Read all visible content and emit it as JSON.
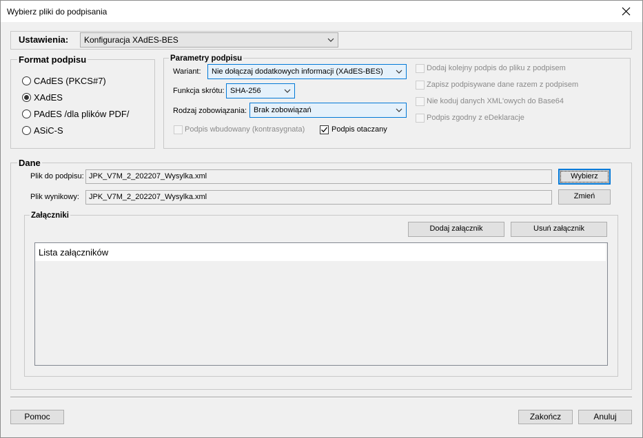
{
  "window": {
    "title": "Wybierz pliki do podpisania"
  },
  "settings": {
    "label": "Ustawienia:",
    "selected": "Konfiguracja XAdES-BES"
  },
  "format": {
    "title": "Format podpisu",
    "options": [
      {
        "label": "CAdES (PKCS#7)",
        "checked": false
      },
      {
        "label": "XAdES",
        "checked": true
      },
      {
        "label": "PAdES /dla plików PDF/",
        "checked": false
      },
      {
        "label": "ASiC-S",
        "checked": false
      }
    ]
  },
  "params": {
    "title": "Parametry podpisu",
    "variant_label": "Wariant:",
    "variant_value": "Nie dołączaj dodatkowych informacji (XAdES-BES)",
    "hash_label": "Funkcja skrótu:",
    "hash_value": "SHA-256",
    "commitment_label": "Rodzaj zobowiązania:",
    "commitment_value": "Brak zobowiązań",
    "embedded_label": "Podpis wbudowany (kontrasygnata)",
    "enveloping_label": "Podpis otaczany",
    "opt_add_signature": "Dodaj kolejny podpis do pliku z podpisem",
    "opt_save_data": "Zapisz podpisywane dane razem z podpisem",
    "opt_no_base64": "Nie koduj danych XML'owych do Base64",
    "opt_edeklaracje": "Podpis zgodny z eDeklaracje"
  },
  "data": {
    "title": "Dane",
    "input_file_label": "Plik do podpisu:",
    "input_file_value": "JPK_V7M_2_202207_Wysylka.xml",
    "choose_button": "Wybierz",
    "output_file_label": "Plik wynikowy:",
    "output_file_value": "JPK_V7M_2_202207_Wysylka.xml",
    "change_button": "Zmień"
  },
  "attachments": {
    "title": "Załączniki",
    "add_button": "Dodaj załącznik",
    "remove_button": "Usuń załącznik",
    "list_header": "Lista załączników"
  },
  "footer": {
    "help_button": "Pomoc",
    "finish_button": "Zakończ",
    "cancel_button": "Anuluj"
  }
}
